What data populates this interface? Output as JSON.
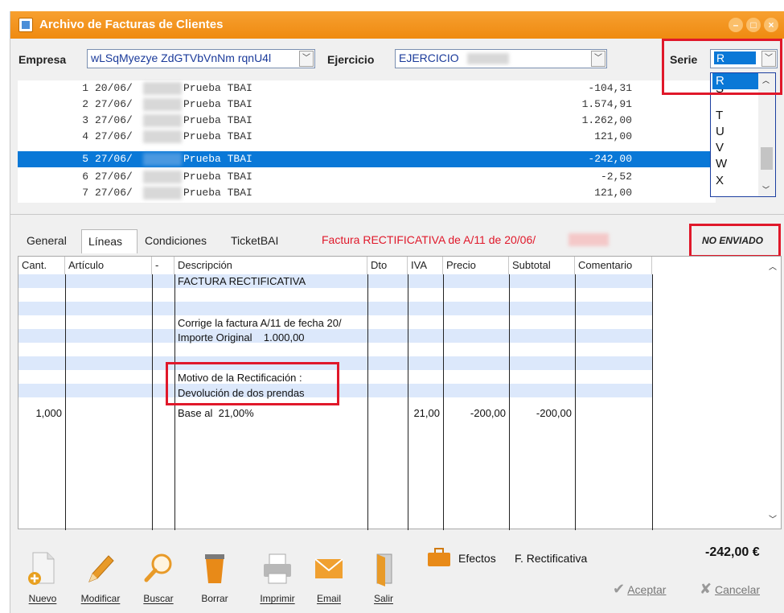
{
  "window": {
    "title": "Archivo de Facturas de Clientes"
  },
  "header": {
    "empresa_label": "Empresa",
    "empresa_value": "wLSqMyezye ZdGTVbVnNm rqnU4l",
    "ejercicio_label": "Ejercicio",
    "ejercicio_value": "EJERCICIO",
    "serie_label": "Serie",
    "serie_value": "R"
  },
  "serie_options": [
    "R",
    "S",
    "T",
    "U",
    "V",
    "W",
    "X"
  ],
  "invoices": [
    {
      "num": "1",
      "date": "20/06/",
      "desc": "Prueba TBAI",
      "amount": "-104,31"
    },
    {
      "num": "2",
      "date": "27/06/",
      "desc": "Prueba TBAI",
      "amount": "1.574,91"
    },
    {
      "num": "3",
      "date": "27/06/",
      "desc": "Prueba TBAI",
      "amount": "1.262,00"
    },
    {
      "num": "4",
      "date": "27/06/",
      "desc": "Prueba TBAI",
      "amount": "121,00"
    },
    {
      "num": "5",
      "date": "27/06/",
      "desc": "Prueba TBAI",
      "amount": "-242,00"
    },
    {
      "num": "6",
      "date": "27/06/",
      "desc": "Prueba TBAI",
      "amount": "-2,52"
    },
    {
      "num": "7",
      "date": "27/06/",
      "desc": "Prueba TBAI",
      "amount": "121,00"
    }
  ],
  "tabs": [
    "General",
    "Líneas",
    "Condiciones",
    "TicketBAI"
  ],
  "rectificativa_note": "Factura RECTIFICATIVA de A/11 de 20/06/",
  "status": "NO ENVIADO",
  "columns": [
    "Cant.",
    "Artículo",
    "-",
    "Descripción",
    "Dto",
    "IVA",
    "Precio",
    "Subtotal",
    "Comentario"
  ],
  "lines": {
    "l1": "FACTURA RECTIFICATIVA",
    "l2": "Corrige la factura A/11 de fecha 20/",
    "l3": "Importe Original    1.000,00",
    "l4": "Motivo de la Rectificación :",
    "l5": "Devolución de dos prendas",
    "l6_cant": "1,000",
    "l6_desc": "Base al  21,00%",
    "l6_iva": "21,00",
    "l6_precio": "-200,00",
    "l6_subtotal": "-200,00"
  },
  "toolbar": {
    "nuevo": "Nuevo",
    "modificar": "Modificar",
    "buscar": "Buscar",
    "borrar": "Borrar",
    "imprimir": "Imprimir",
    "email": "Email",
    "salir": "Salir"
  },
  "actions": {
    "efectos": "Efectos",
    "rectificativa": "F. Rectificativa",
    "total": "-242,00 €",
    "aceptar": "Aceptar",
    "cancelar": "Cancelar"
  },
  "colors": {
    "accent": "#ef8a10",
    "selection": "#0a78d7",
    "alert": "#e0182a"
  }
}
